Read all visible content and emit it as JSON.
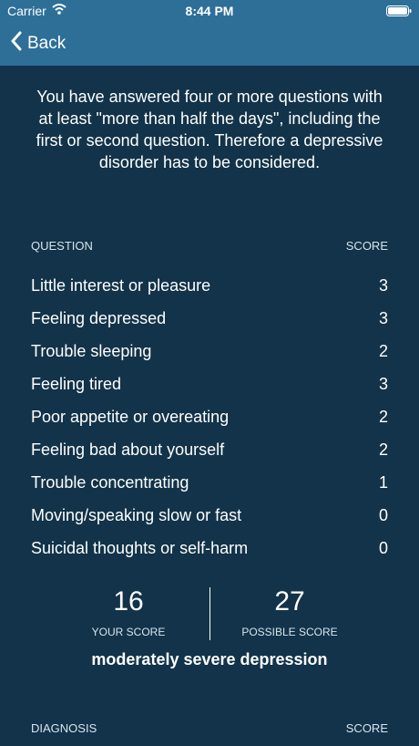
{
  "status_bar": {
    "carrier": "Carrier",
    "time": "8:44 PM",
    "wifi_icon": "wifi-icon",
    "battery_icon": "battery-icon"
  },
  "nav": {
    "back_label": "Back",
    "back_icon": "chevron-left-icon"
  },
  "intro_text": "You have answered four or more questions with at least \"more than half the days\", including the first or second question. Therefore a depressive disorder has to be considered.",
  "questions_header": {
    "question": "QUESTION",
    "score": "SCORE"
  },
  "questions": [
    {
      "label": "Little interest or pleasure",
      "score": "3"
    },
    {
      "label": "Feeling depressed",
      "score": "3"
    },
    {
      "label": "Trouble sleeping",
      "score": "2"
    },
    {
      "label": "Feeling tired",
      "score": "3"
    },
    {
      "label": "Poor appetite or overeating",
      "score": "2"
    },
    {
      "label": "Feeling bad about yourself",
      "score": "2"
    },
    {
      "label": "Trouble concentrating",
      "score": "1"
    },
    {
      "label": "Moving/speaking slow or fast",
      "score": "0"
    },
    {
      "label": "Suicidal thoughts or self-harm",
      "score": "0"
    }
  ],
  "summary": {
    "your_score": "16",
    "your_score_label": "YOUR SCORE",
    "possible_score": "27",
    "possible_score_label": "POSSIBLE SCORE",
    "severity": "moderately severe depression"
  },
  "diagnosis_header": {
    "diagnosis": "DIAGNOSIS",
    "score": "SCORE"
  },
  "colors": {
    "nav_background": "#2e6f98",
    "page_background": "#123349"
  }
}
